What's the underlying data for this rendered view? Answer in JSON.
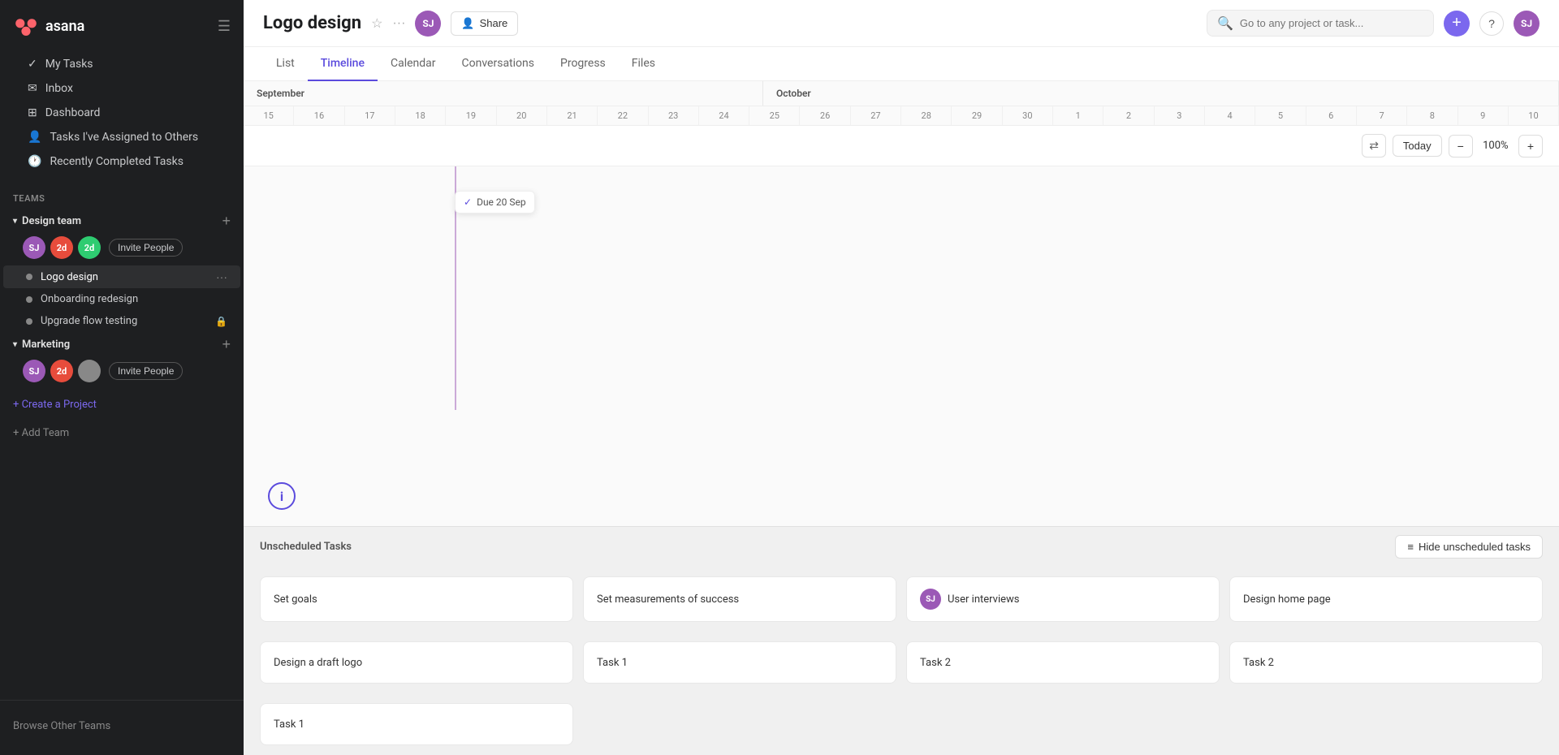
{
  "sidebar": {
    "logo_text": "asana",
    "nav_items": [
      {
        "id": "my-tasks",
        "label": "My Tasks"
      },
      {
        "id": "inbox",
        "label": "Inbox"
      },
      {
        "id": "dashboard",
        "label": "Dashboard"
      },
      {
        "id": "tasks-assigned",
        "label": "Tasks I've Assigned to Others"
      },
      {
        "id": "recently-completed",
        "label": "Recently Completed Tasks"
      }
    ],
    "teams_label": "Teams",
    "teams": [
      {
        "id": "design-team",
        "name": "Design team",
        "expanded": true,
        "members": [
          {
            "initials": "SJ",
            "color": "#9b59b6"
          },
          {
            "initials": "2d",
            "color": "#e74c3c"
          },
          {
            "initials": "2d",
            "color": "#2ecc71"
          }
        ],
        "invite_label": "Invite People",
        "projects": [
          {
            "id": "logo-design",
            "name": "Logo design",
            "color": "#888",
            "active": true
          },
          {
            "id": "onboarding-redesign",
            "name": "Onboarding redesign",
            "color": "#888",
            "active": false
          },
          {
            "id": "upgrade-flow-testing",
            "name": "Upgrade flow testing",
            "color": "#888",
            "active": false,
            "locked": true
          }
        ]
      },
      {
        "id": "marketing",
        "name": "Marketing",
        "expanded": true,
        "members": [
          {
            "initials": "SJ",
            "color": "#9b59b6"
          },
          {
            "initials": "2d",
            "color": "#e74c3c"
          },
          {
            "initials": "",
            "color": "#888"
          }
        ],
        "invite_label": "Invite People",
        "projects": []
      }
    ],
    "create_project_label": "+ Create a Project",
    "add_team_label": "+ Add Team",
    "browse_teams_label": "Browse Other Teams"
  },
  "header": {
    "project_title": "Logo design",
    "share_label": "Share",
    "search_placeholder": "Go to any project or task...",
    "user_initials": "SJ"
  },
  "tabs": [
    {
      "id": "list",
      "label": "List"
    },
    {
      "id": "timeline",
      "label": "Timeline",
      "active": true
    },
    {
      "id": "calendar",
      "label": "Calendar"
    },
    {
      "id": "conversations",
      "label": "Conversations"
    },
    {
      "id": "progress",
      "label": "Progress"
    },
    {
      "id": "files",
      "label": "Files"
    }
  ],
  "timeline": {
    "months": [
      {
        "label": "September",
        "id": "september"
      },
      {
        "label": "October",
        "id": "october"
      }
    ],
    "days_september": [
      "15",
      "16",
      "17",
      "18",
      "19",
      "20",
      "21",
      "22",
      "23",
      "24",
      "25",
      "26",
      "27",
      "28",
      "29",
      "30"
    ],
    "days_october": [
      "1",
      "2",
      "3",
      "4",
      "5",
      "6",
      "7",
      "8",
      "9",
      "10"
    ],
    "controls": {
      "today_label": "Today",
      "zoom_level": "100%",
      "zoom_in_label": "+",
      "zoom_out_label": "−"
    },
    "tooltip": {
      "check": "✓",
      "text": "Due 20 Sep"
    },
    "info_icon": "i",
    "hide_unscheduled_label": "Hide unscheduled tasks"
  },
  "unscheduled": {
    "section_label": "Unscheduled Tasks",
    "tasks_row1": [
      {
        "id": "set-goals",
        "label": "Set goals",
        "has_avatar": false
      },
      {
        "id": "set-measurements",
        "label": "Set measurements of success",
        "has_avatar": false
      },
      {
        "id": "user-interviews",
        "label": "User interviews",
        "has_avatar": true,
        "avatar_initials": "SJ",
        "avatar_color": "#9b59b6"
      },
      {
        "id": "design-home-page",
        "label": "Design home page",
        "has_avatar": false
      }
    ],
    "tasks_row2": [
      {
        "id": "design-draft-logo",
        "label": "Design a draft logo",
        "has_avatar": false
      },
      {
        "id": "task-1-row2",
        "label": "Task 1",
        "has_avatar": false
      },
      {
        "id": "task-2-row2",
        "label": "Task 2",
        "has_avatar": false
      },
      {
        "id": "task-2b-row2",
        "label": "Task 2",
        "has_avatar": false
      }
    ],
    "tasks_row3": [
      {
        "id": "task-1-row3",
        "label": "Task 1",
        "has_avatar": false
      }
    ]
  }
}
